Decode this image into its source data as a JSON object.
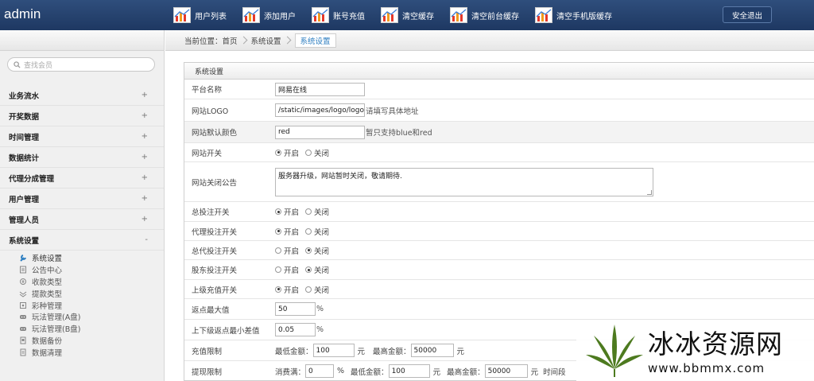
{
  "app": {
    "brand": "admin",
    "logout": "安全退出"
  },
  "nav": [
    {
      "label": "用户列表"
    },
    {
      "label": "添加用户"
    },
    {
      "label": "账号充值"
    },
    {
      "label": "清空缓存"
    },
    {
      "label": "清空前台缓存"
    },
    {
      "label": "清空手机版缓存"
    }
  ],
  "breadcrumb": {
    "prefix": "当前位置：首页",
    "middle": "系统设置",
    "current": "系统设置"
  },
  "search": {
    "placeholder": "查找会员"
  },
  "menu": [
    {
      "label": "业务流水",
      "sign": "+"
    },
    {
      "label": "开奖数据",
      "sign": "+"
    },
    {
      "label": "时间管理",
      "sign": "+"
    },
    {
      "label": "数据统计",
      "sign": "+"
    },
    {
      "label": "代理分成管理",
      "sign": "+"
    },
    {
      "label": "用户管理",
      "sign": "+"
    },
    {
      "label": "管理人员",
      "sign": "+"
    },
    {
      "label": "系统设置",
      "sign": "-"
    }
  ],
  "submenu": [
    {
      "label": "系统设置",
      "icon": "wrench-icon"
    },
    {
      "label": "公告中心",
      "icon": "notice-icon"
    },
    {
      "label": "收款类型",
      "icon": "receive-icon"
    },
    {
      "label": "提款类型",
      "icon": "withdraw-icon"
    },
    {
      "label": "彩种管理",
      "icon": "lottery-icon"
    },
    {
      "label": "玩法管理(A盘)",
      "icon": "gamepad-icon"
    },
    {
      "label": "玩法管理(B盘)",
      "icon": "gamepad-icon"
    },
    {
      "label": "数据备份",
      "icon": "backup-icon"
    },
    {
      "label": "数据清理",
      "icon": "cleanup-icon"
    }
  ],
  "panel": {
    "title": "系统设置"
  },
  "radio": {
    "on": "开启",
    "off": "关闭"
  },
  "form": {
    "platform_name": {
      "label": "平台名称",
      "value": "网易在线"
    },
    "logo": {
      "label": "网站LOGO",
      "value": "/static/images/logo/logo_zc",
      "hint": "请填写具体地址"
    },
    "color": {
      "label": "网站默认颜色",
      "value": "red",
      "hint": "暂只支持blue和red"
    },
    "site_switch": {
      "label": "网站开关",
      "selected": "on"
    },
    "close_notice": {
      "label": "网站关闭公告",
      "value": "服务器升级，网站暂时关闭，敬请期待."
    },
    "total_bet": {
      "label": "总投注开关",
      "selected": "on"
    },
    "agent_bet": {
      "label": "代理投注开关",
      "selected": "on"
    },
    "general_agent_bet": {
      "label": "总代投注开关",
      "selected": "off"
    },
    "shareholder_bet": {
      "label": "股东投注开关",
      "selected": "off"
    },
    "superior_recharge": {
      "label": "上级充值开关",
      "selected": "on"
    },
    "rebate_max": {
      "label": "返点最大值",
      "value": "50",
      "unit": "%"
    },
    "rebate_diff": {
      "label": "上下级返点最小差值",
      "value": "0.05",
      "unit": "%"
    },
    "recharge_limit": {
      "label": "充值限制",
      "min_label": "最低金额：",
      "min": "100",
      "min_unit": "元",
      "max_label": "最高金额：",
      "max": "50000",
      "max_unit": "元"
    },
    "withdraw_limit": {
      "label": "提现限制",
      "consume_label": "消费满：",
      "consume": "0",
      "consume_unit": "%",
      "min_label": "最低金额：",
      "min": "100",
      "min_unit": "元",
      "max_label": "最高金额：",
      "max": "50000",
      "max_unit": "元",
      "time_label": "时间段"
    }
  },
  "watermark": {
    "title": "冰冰资源网",
    "url": "www.bbmmx.com"
  }
}
